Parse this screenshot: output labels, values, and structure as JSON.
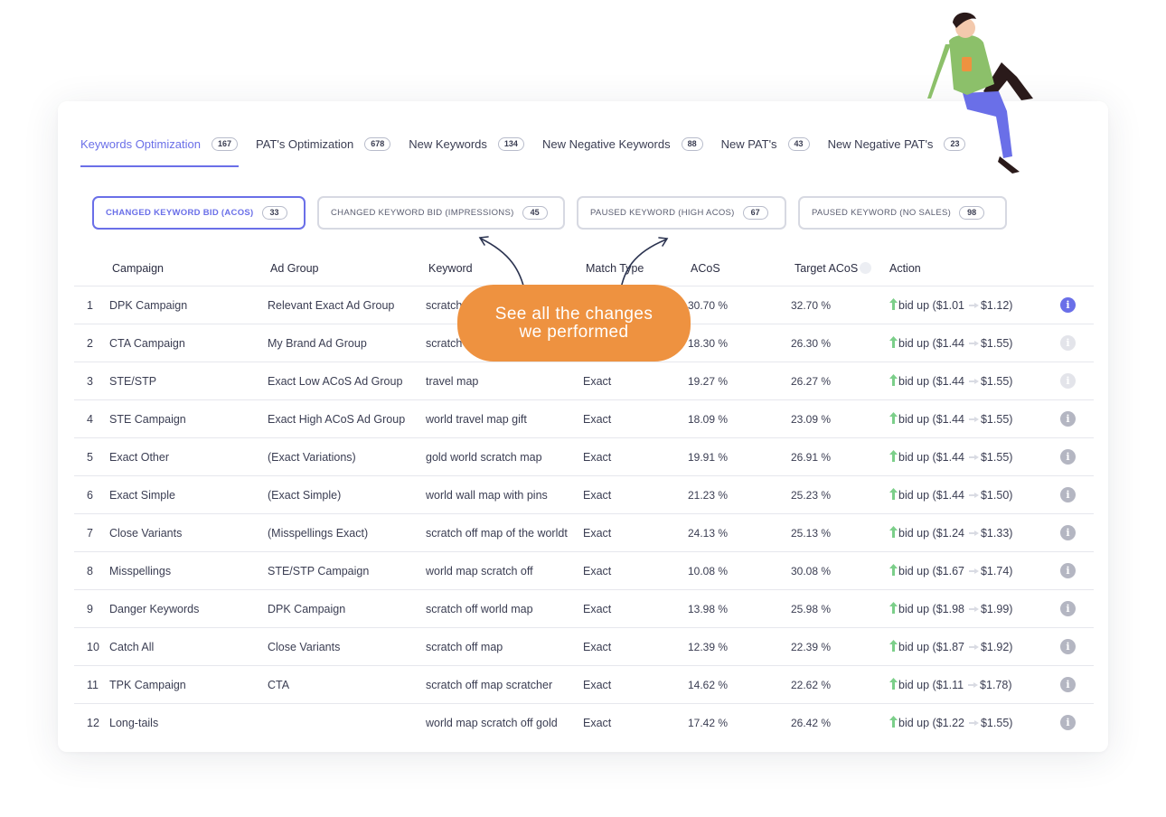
{
  "tabs": [
    {
      "label": "Keywords Optimization",
      "count": "167",
      "active": true
    },
    {
      "label": "PAT's Optimization",
      "count": "678"
    },
    {
      "label": "New Keywords",
      "count": "134"
    },
    {
      "label": "New Negative Keywords",
      "count": "88"
    },
    {
      "label": "New PAT's",
      "count": "43"
    },
    {
      "label": "New Negative PAT's",
      "count": "23"
    }
  ],
  "filters": [
    {
      "label": "CHANGED KEYWORD BID (ACOS)",
      "count": "33",
      "active": true
    },
    {
      "label": "CHANGED KEYWORD BID (IMPRESSIONS)",
      "count": "45"
    },
    {
      "label": "PAUSED KEYWORD (HIGH ACOS)",
      "count": "67"
    },
    {
      "label": "PAUSED KEYWORD (NO SALES)",
      "count": "98"
    }
  ],
  "columns": {
    "campaign": "Campaign",
    "ad_group": "Ad Group",
    "keyword": "Keyword",
    "match_type": "Match Type",
    "acos": "ACoS",
    "target_acos": "Target ACoS",
    "action": "Action"
  },
  "rows": [
    {
      "n": "1",
      "campaign": "DPK Campaign",
      "ad_group": "Relevant Exact Ad Group",
      "keyword": "scratch",
      "match": "",
      "acos": "30.70 %",
      "target": "32.70 %",
      "from": "bid up ($1.01",
      "to": "$1.12)"
    },
    {
      "n": "2",
      "campaign": "CTA Campaign",
      "ad_group": "My Brand Ad Group",
      "keyword": "scratch",
      "match": "",
      "acos": "18.30 %",
      "target": "26.30 %",
      "from": "bid up ($1.44",
      "to": "$1.55)"
    },
    {
      "n": "3",
      "campaign": "STE/STP",
      "ad_group": "Exact Low ACoS Ad Group",
      "keyword": "travel map",
      "match": "Exact",
      "acos": "19.27 %",
      "target": "26.27 %",
      "from": "bid up ($1.44",
      "to": "$1.55)"
    },
    {
      "n": "4",
      "campaign": "STE Campaign",
      "ad_group": "Exact High ACoS Ad Group",
      "keyword": "world travel map gift",
      "match": "Exact",
      "acos": "18.09 %",
      "target": "23.09 %",
      "from": "bid up ($1.44",
      "to": "$1.55)"
    },
    {
      "n": "5",
      "campaign": "Exact Other",
      "ad_group": "(Exact Variations)",
      "keyword": "gold world scratch map",
      "match": "Exact",
      "acos": "19.91 %",
      "target": "26.91 %",
      "from": "bid up ($1.44",
      "to": "$1.55)"
    },
    {
      "n": "6",
      "campaign": "Exact Simple",
      "ad_group": "(Exact Simple)",
      "keyword": "world wall map with pins",
      "match": "Exact",
      "acos": "21.23 %",
      "target": "25.23 %",
      "from": "bid up ($1.44",
      "to": "$1.50)"
    },
    {
      "n": "7",
      "campaign": "Close Variants",
      "ad_group": "(Misspellings Exact)",
      "keyword": "scratch off map of the worldt",
      "match": "Exact",
      "acos": "24.13 %",
      "target": "25.13 %",
      "from": "bid up ($1.24",
      "to": "$1.33)"
    },
    {
      "n": "8",
      "campaign": "Misspellings",
      "ad_group": "STE/STP Campaign",
      "keyword": "world map scratch off",
      "match": "Exact",
      "acos": "10.08 %",
      "target": "30.08 %",
      "from": "bid up ($1.67",
      "to": "$1.74)"
    },
    {
      "n": "9",
      "campaign": "Danger Keywords",
      "ad_group": "DPK Campaign",
      "keyword": "scratch off world map",
      "match": "Exact",
      "acos": "13.98 %",
      "target": "25.98 %",
      "from": "bid up ($1.98",
      "to": "$1.99)"
    },
    {
      "n": "10",
      "campaign": "Catch All",
      "ad_group": "Close Variants",
      "keyword": "scratch off map",
      "match": "Exact",
      "acos": "12.39 %",
      "target": "22.39 %",
      "from": "bid up ($1.87",
      "to": "$1.92)"
    },
    {
      "n": "11",
      "campaign": "TPK Campaign",
      "ad_group": "CTA",
      "keyword": "scratch off map scratcher",
      "match": "Exact",
      "acos": "14.62 %",
      "target": "22.62 %",
      "from": "bid up ($1.11",
      "to": "$1.78)"
    },
    {
      "n": "12",
      "campaign": "Long-tails",
      "ad_group": "",
      "keyword": "world map scratch off gold",
      "match": "Exact",
      "acos": "17.42 %",
      "target": "26.42 %",
      "from": "bid up ($1.22",
      "to": "$1.55)"
    }
  ],
  "callout": {
    "line1": "See all the changes",
    "line2": "we performed"
  },
  "colors": {
    "accent": "#6a6fe8",
    "callout": "#ee9240",
    "up_arrow": "#7ccf8a"
  },
  "icons": {
    "info": "info-icon",
    "up": "arrow-up-icon",
    "right": "arrow-right-icon"
  }
}
